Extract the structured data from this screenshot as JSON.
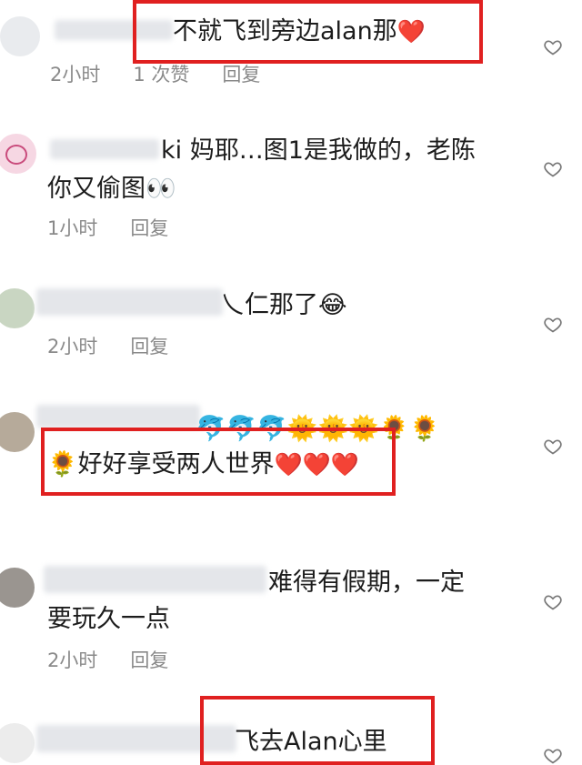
{
  "comments": [
    {
      "text": "不就飞到旁边alan那",
      "emoji": "❤️",
      "time": "2小时",
      "likes": "1 次赞",
      "reply": "回复"
    },
    {
      "user_tail": "ki",
      "line1": "妈耶…图1是我做的，老陈",
      "line2": "你又偷图",
      "emoji": "👀",
      "time": "1小时",
      "reply": "回复"
    },
    {
      "text": "乀仁那了",
      "emoji": "😂",
      "time": "2小时",
      "reply": "回复"
    },
    {
      "top_emojis": "🐬🐬🐬🌞🌞🌞🌻🌻",
      "text": "好好享受两人世界",
      "lead_emoji": "🌻",
      "hearts": "❤️❤️❤️"
    },
    {
      "line1": "难得有假期，一定",
      "line2": "要玩久一点",
      "time": "2小时",
      "reply": "回复"
    },
    {
      "text": "飞去Alan心里"
    }
  ],
  "icons": {
    "like": "heart-outline-icon"
  },
  "colors": {
    "highlight": "#e02020",
    "meta": "#8a8a8a"
  }
}
